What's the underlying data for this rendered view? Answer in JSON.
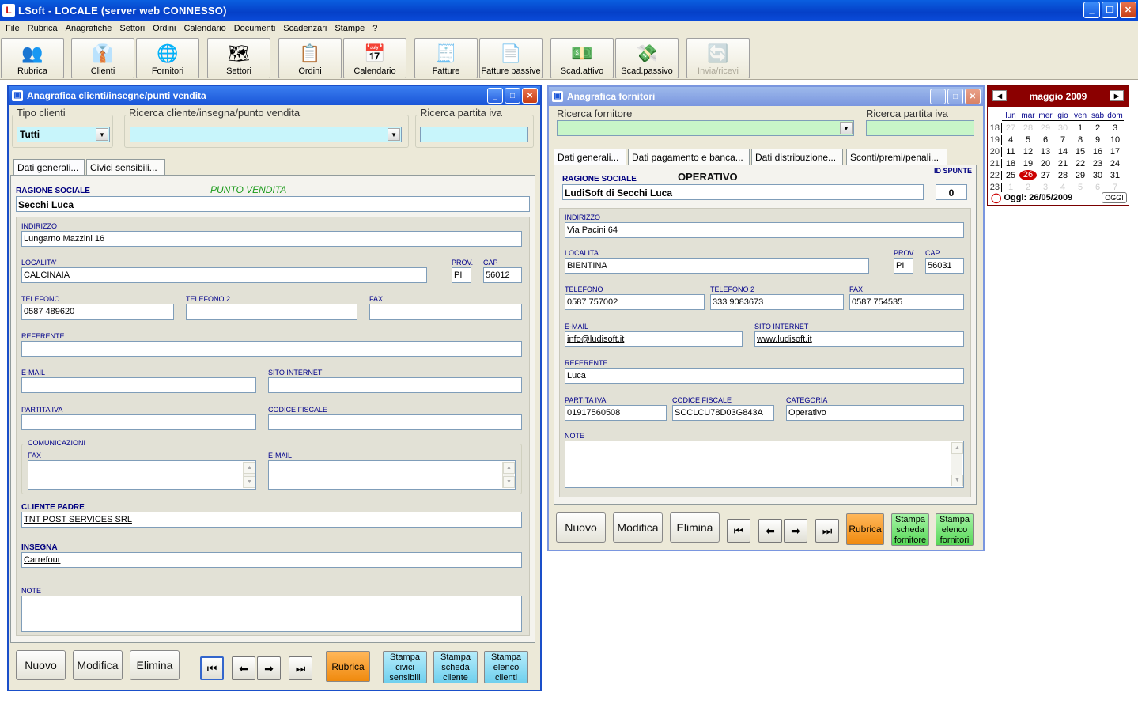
{
  "app": {
    "title": "LSoft - LOCALE  (server web CONNESSO)"
  },
  "menu": [
    "File",
    "Rubrica",
    "Anagrafiche",
    "Settori",
    "Ordini",
    "Calendario",
    "Documenti",
    "Scadenzari",
    "Stampe",
    "?"
  ],
  "toolbar": [
    {
      "label": "Rubrica",
      "icon": "people-icon"
    },
    {
      "label": "Clienti",
      "icon": "client-icon"
    },
    {
      "label": "Fornitori",
      "icon": "supplier-icon"
    },
    {
      "label": "Settori",
      "icon": "italy-map-icon"
    },
    {
      "label": "Ordini",
      "icon": "clipboard-icon"
    },
    {
      "label": "Calendario",
      "icon": "calendar-icon"
    },
    {
      "label": "Fatture",
      "icon": "invoice-icon"
    },
    {
      "label": "Fatture passive",
      "icon": "passive-invoice-icon"
    },
    {
      "label": "Scad.attivo",
      "icon": "money-in-icon"
    },
    {
      "label": "Scad.passivo",
      "icon": "money-out-icon"
    },
    {
      "label": "Invia/ricevi",
      "icon": "sync-icon",
      "disabled": true
    }
  ],
  "clienti": {
    "title": "Anagrafica clienti/insegne/punti vendita",
    "tipo_label": "Tipo clienti",
    "tipo_value": "Tutti",
    "ricerca_label": "Ricerca cliente/insegna/punto vendita",
    "ricerca_value": "",
    "piva_label": "Ricerca partita iva",
    "piva_value": "",
    "tabs": [
      "Dati generali...",
      "Civici sensibili..."
    ],
    "ragione_label": "RAGIONE SOCIALE",
    "tipo_record": "PUNTO VENDITA",
    "ragione_value": "Secchi Luca",
    "indirizzo_label": "INDIRIZZO",
    "indirizzo_value": "Lungarno Mazzini 16",
    "localita_label": "LOCALITA'",
    "localita_value": "CALCINAIA",
    "prov_label": "PROV.",
    "prov_value": "PI",
    "cap_label": "CAP",
    "cap_value": "56012",
    "tel_label": "TELEFONO",
    "tel_value": "0587 489620",
    "tel2_label": "TELEFONO 2",
    "tel2_value": "",
    "fax_label": "FAX",
    "fax_value": "",
    "referente_label": "REFERENTE",
    "referente_value": "",
    "email_label": "E-MAIL",
    "email_value": "",
    "sito_label": "SITO INTERNET",
    "sito_value": "",
    "piva2_label": "PARTITA IVA",
    "piva2_value": "",
    "cf_label": "CODICE FISCALE",
    "cf_value": "",
    "comunicazioni_label": "COMUNICAZIONI",
    "com_fax_label": "FAX",
    "com_email_label": "E-MAIL",
    "padre_label": "CLIENTE PADRE",
    "padre_value": "TNT POST SERVICES SRL",
    "insegna_label": "INSEGNA",
    "insegna_value": "Carrefour",
    "note_label": "NOTE",
    "note_value": "",
    "buttons": {
      "nuovo": "Nuovo",
      "modifica": "Modifica",
      "elimina": "Elimina",
      "rubrica": "Rubrica",
      "stampa_civici": "Stampa civici sensibili",
      "stampa_scheda": "Stampa scheda cliente",
      "stampa_elenco": "Stampa elenco clienti"
    }
  },
  "fornitori": {
    "title": "Anagrafica fornitori",
    "ricerca_label": "Ricerca fornitore",
    "ricerca_value": "",
    "piva_label": "Ricerca partita iva",
    "piva_value": "",
    "tabs": [
      "Dati generali...",
      "Dati pagamento e banca...",
      "Dati distribuzione...",
      "Sconti/premi/penali..."
    ],
    "ragione_label": "RAGIONE SOCIALE",
    "tipo_record": "OPERATIVO",
    "id_label": "ID SPUNTE",
    "id_value": "0",
    "ragione_value": "LudiSoft di Secchi Luca",
    "indirizzo_label": "INDIRIZZO",
    "indirizzo_value": "Via Pacini 64",
    "localita_label": "LOCALITA'",
    "localita_value": "BIENTINA",
    "prov_label": "PROV.",
    "prov_value": "PI",
    "cap_label": "CAP",
    "cap_value": "56031",
    "tel_label": "TELEFONO",
    "tel_value": "0587 757002",
    "tel2_label": "TELEFONO 2",
    "tel2_value": "333 9083673",
    "fax_label": "FAX",
    "fax_value": "0587 754535",
    "email_label": "E-MAIL",
    "email_value": "info@ludisoft.it",
    "sito_label": "SITO INTERNET",
    "sito_value": "www.ludisoft.it",
    "referente_label": "REFERENTE",
    "referente_value": "Luca",
    "piva2_label": "PARTITA IVA",
    "piva2_value": "01917560508",
    "cf_label": "CODICE FISCALE",
    "cf_value": "SCCLCU78D03G843A",
    "categoria_label": "CATEGORIA",
    "categoria_value": "Operativo",
    "note_label": "NOTE",
    "note_value": "",
    "buttons": {
      "nuovo": "Nuovo",
      "modifica": "Modifica",
      "elimina": "Elimina",
      "rubrica": "Rubrica",
      "stampa_scheda": "Stampa scheda fornitore",
      "stampa_elenco": "Stampa elenco fornitori"
    }
  },
  "calendar": {
    "month": "maggio 2009",
    "days_header": [
      "lun",
      "mar",
      "mer",
      "gio",
      "ven",
      "sab",
      "dom"
    ],
    "weeks": [
      {
        "wk": "18",
        "days": [
          "27",
          "28",
          "29",
          "30",
          "1",
          "2",
          "3"
        ],
        "other": [
          0,
          1,
          2,
          3
        ]
      },
      {
        "wk": "19",
        "days": [
          "4",
          "5",
          "6",
          "7",
          "8",
          "9",
          "10"
        ],
        "other": []
      },
      {
        "wk": "20",
        "days": [
          "11",
          "12",
          "13",
          "14",
          "15",
          "16",
          "17"
        ],
        "other": []
      },
      {
        "wk": "21",
        "days": [
          "18",
          "19",
          "20",
          "21",
          "22",
          "23",
          "24"
        ],
        "other": []
      },
      {
        "wk": "22",
        "days": [
          "25",
          "26",
          "27",
          "28",
          "29",
          "30",
          "31"
        ],
        "other": [],
        "today": 1
      },
      {
        "wk": "23",
        "days": [
          "1",
          "2",
          "3",
          "4",
          "5",
          "6",
          "7"
        ],
        "other": [
          0,
          1,
          2,
          3,
          4,
          5,
          6
        ]
      }
    ],
    "today_text": "Oggi: 26/05/2009",
    "today_button": "OGGI"
  },
  "colors": {
    "title_blue": "#1a55d8",
    "search_green": "#c8f5c8",
    "rubrica_orange": "#f08a0e",
    "stampa_cyan": "#6fd0ee",
    "stampa_green": "#57d857",
    "calendar_red": "#8b0000"
  }
}
